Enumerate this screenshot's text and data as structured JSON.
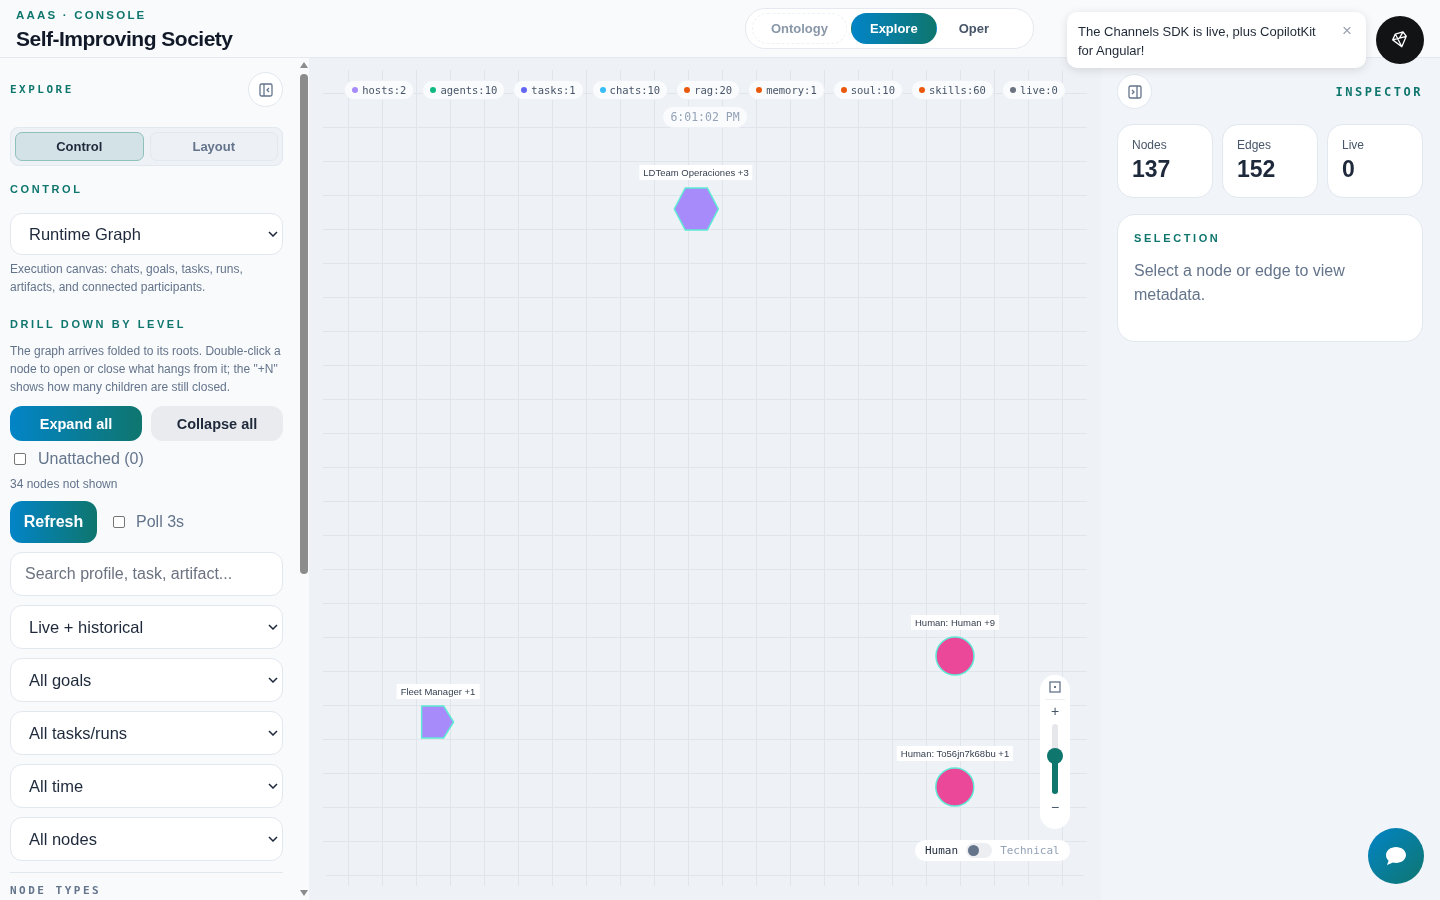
{
  "header": {
    "eyebrow": "AAAS · CONSOLE",
    "title": "Self-Improving Society"
  },
  "nav_tabs": [
    {
      "label": "Ontology",
      "selected": false
    },
    {
      "label": "Explore",
      "selected": true
    },
    {
      "label": "Oper",
      "selected": false
    }
  ],
  "toast": {
    "message": "The Channels SDK is live, plus CopilotKit for Angular!",
    "close": "×"
  },
  "sidebar": {
    "title": "EXPLORE",
    "segments": [
      {
        "label": "Control",
        "selected": true
      },
      {
        "label": "Layout",
        "selected": false
      }
    ],
    "control_heading": "CONTROL",
    "view_select": "Runtime Graph",
    "view_description": "Execution canvas: chats, goals, tasks, runs, artifacts, and connected participants.",
    "drill_heading": "DRILL DOWN BY LEVEL",
    "drill_description": "The graph arrives folded to its roots. Double-click a node to open or close what hangs from it; the \"+N\" shows how many children are still closed.",
    "expand_button": "Expand all",
    "collapse_button": "Collapse all",
    "unattached": {
      "label": "Unattached (0)",
      "checked": false
    },
    "hidden_note": "34 nodes not shown",
    "refresh_button": "Refresh",
    "poll": {
      "label": "Poll 3s",
      "checked": false
    },
    "search": {
      "placeholder": "Search profile, task, artifact..."
    },
    "filters": [
      "Live + historical",
      "All goals",
      "All tasks/runs",
      "All time",
      "All nodes"
    ],
    "node_types_heading": "NODE TYPES"
  },
  "canvas": {
    "chips": [
      {
        "label": "hosts:2",
        "color": "#a78bfa"
      },
      {
        "label": "agents:10",
        "color": "#10b981"
      },
      {
        "label": "tasks:1",
        "color": "#6366f1"
      },
      {
        "label": "chats:10",
        "color": "#38bdf8"
      },
      {
        "label": "rag:20",
        "color": "#ea580c"
      },
      {
        "label": "memory:1",
        "color": "#ea580c"
      },
      {
        "label": "soul:10",
        "color": "#ea580c"
      },
      {
        "label": "skills:60",
        "color": "#ea580c"
      },
      {
        "label": "live:0",
        "color": "#6b7280"
      },
      {
        "label": "6:01:02 PM"
      }
    ],
    "nodes": [
      {
        "label": "LDTeam Operaciones",
        "badge": "+3",
        "kind": "hexagon",
        "color": "#a78bfa"
      },
      {
        "label": "Human: Human",
        "badge": "+9",
        "kind": "circle",
        "color": "#ec4899"
      },
      {
        "label": "Fleet Manager",
        "badge": "+1",
        "kind": "pentagon",
        "color": "#a78bfa"
      },
      {
        "label": "Human: To56jn7k68bu",
        "badge": "+1",
        "kind": "circle",
        "color": "#ec4899"
      }
    ],
    "zoom": {
      "plus": "+",
      "minus": "−",
      "level": 0.55
    },
    "mode_toggle": [
      {
        "label": "Human",
        "selected": true
      },
      {
        "label": "Technical",
        "selected": false
      }
    ]
  },
  "inspector": {
    "title": "INSPECTOR",
    "stats": [
      {
        "label": "Nodes",
        "value": "137"
      },
      {
        "label": "Edges",
        "value": "152"
      },
      {
        "label": "Live",
        "value": "0"
      }
    ],
    "selection_heading": "SELECTION",
    "selection_text": "Select a node or edge to view metadata."
  }
}
